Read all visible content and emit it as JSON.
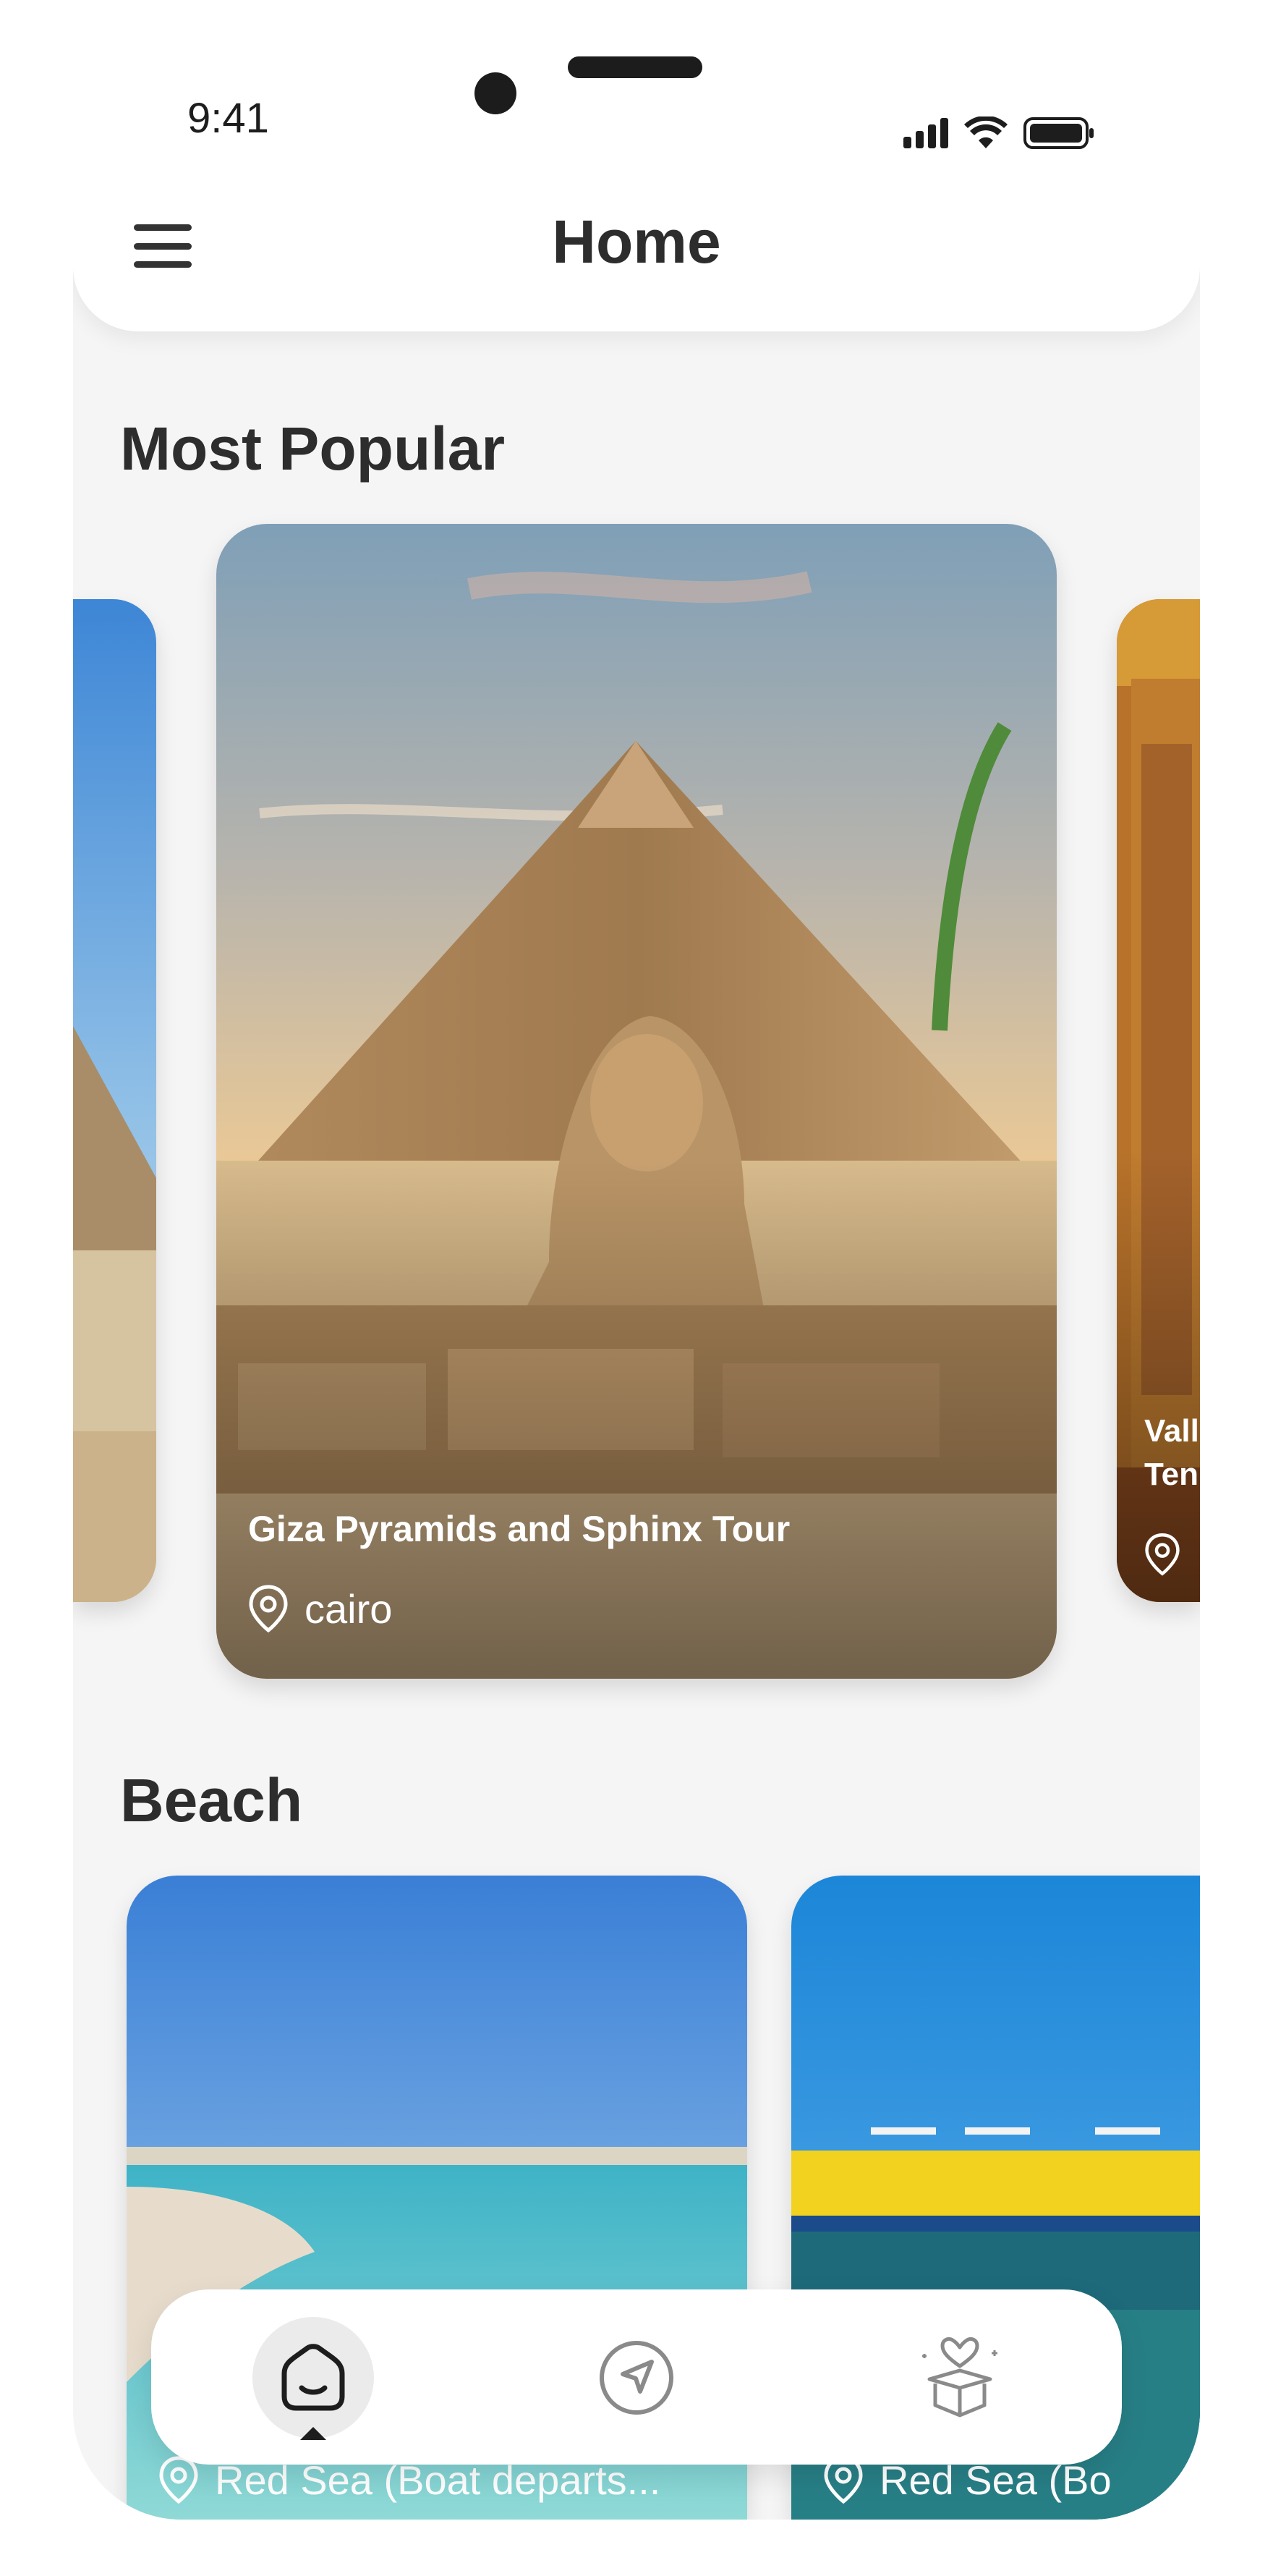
{
  "status_bar": {
    "time": "9:41"
  },
  "header": {
    "title": "Home",
    "menu_icon": "hamburger-menu-icon"
  },
  "sections": {
    "popular": {
      "title": "Most Popular",
      "cards": [
        {
          "title": "",
          "location": ""
        },
        {
          "title": "Giza Pyramids and Sphinx Tour",
          "location": "cairo"
        },
        {
          "title_line1": "Vall",
          "title_line2": "Ten",
          "location": ""
        }
      ]
    },
    "beach": {
      "title": "Beach",
      "cards": [
        {
          "location": "Red Sea (Boat departs..."
        },
        {
          "location": "Red Sea (Bo"
        }
      ]
    }
  },
  "bottom_nav": {
    "items": [
      {
        "icon": "home-icon",
        "active": true
      },
      {
        "icon": "navigation-arrow-icon",
        "active": false
      },
      {
        "icon": "gift-box-heart-icon",
        "active": false
      }
    ]
  },
  "colors": {
    "background": "#f5f5f5",
    "text": "#2d2d2d",
    "active_nav": "#ebebeb"
  }
}
